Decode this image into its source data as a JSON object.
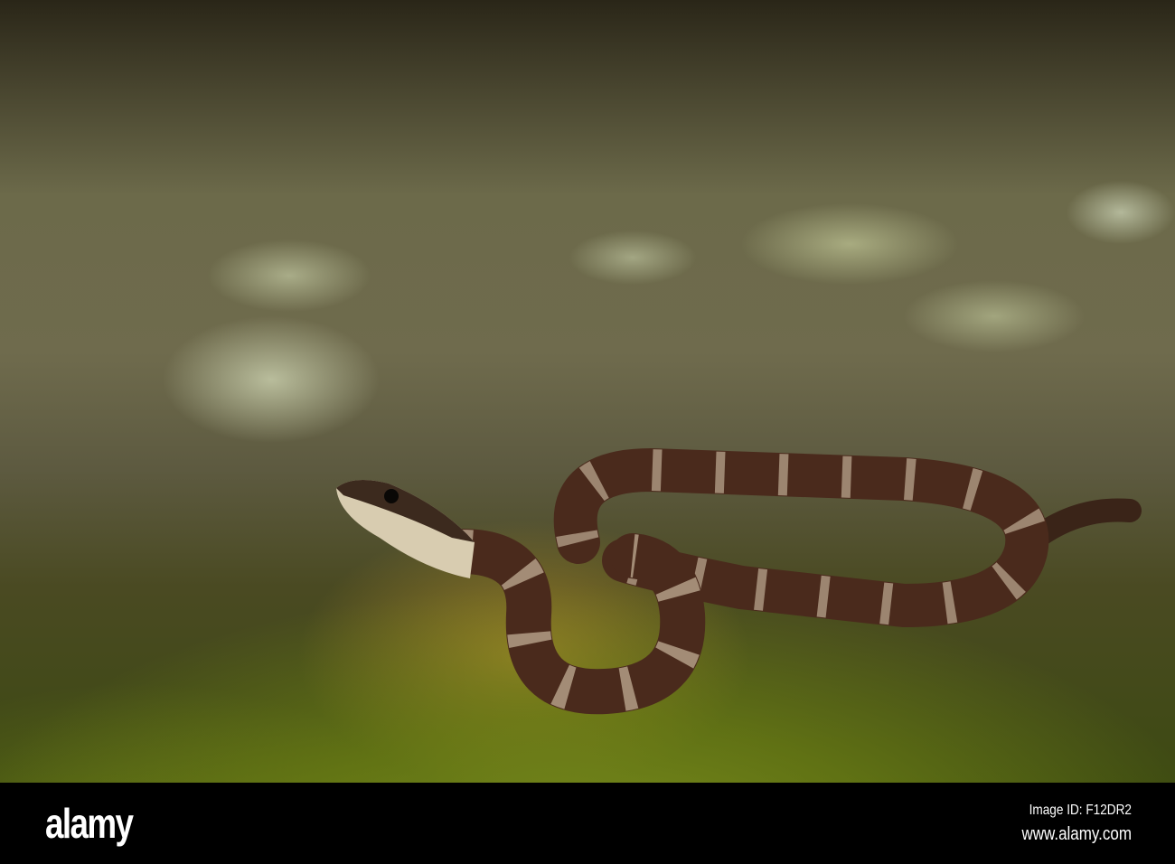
{
  "watermark": {
    "brand": "alamy",
    "image_id": "Image ID: F12DR2",
    "url": "www.alamy.com"
  },
  "colors": {
    "snake_dark": "#4a2a1c",
    "snake_band": "#b8a48c",
    "moss": "#7c8f1d",
    "rock": "#6f6b4d"
  }
}
